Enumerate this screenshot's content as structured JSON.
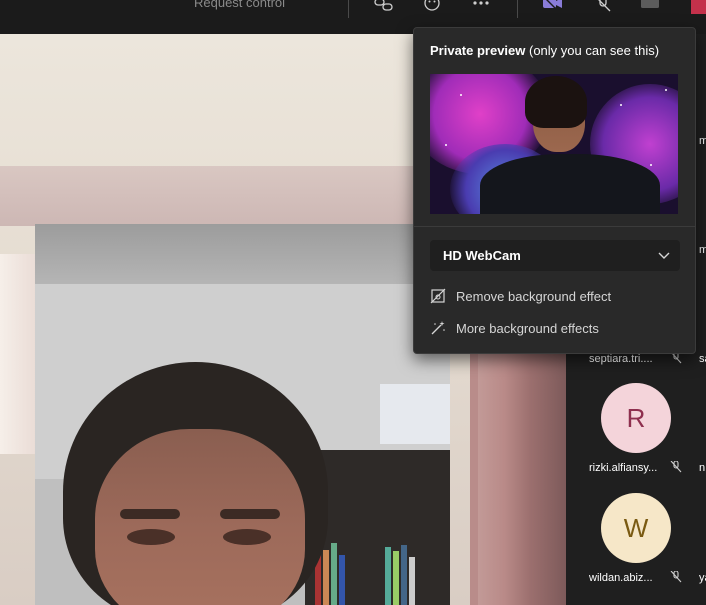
{
  "toolbar": {
    "request_control": "Request control"
  },
  "popup": {
    "title_bold": "Private preview",
    "title_rest": " (only you can see this)",
    "camera": "HD WebCam",
    "menu": [
      {
        "label": "Remove background effect",
        "icon": "remove-background-icon"
      },
      {
        "label": "More background effects",
        "icon": "magic-wand-icon"
      }
    ]
  },
  "participants": [
    {
      "name": "septiara.tri....",
      "cut": "sa"
    },
    {
      "name": "rizki.alfiansy...",
      "cut": "n",
      "initial": "R",
      "color": "#f4d4da"
    },
    {
      "name": "wildan.abiz...",
      "cut": "ya",
      "initial": "W",
      "color": "#f6e7c8"
    }
  ],
  "cut_letters": [
    "m",
    "m"
  ]
}
